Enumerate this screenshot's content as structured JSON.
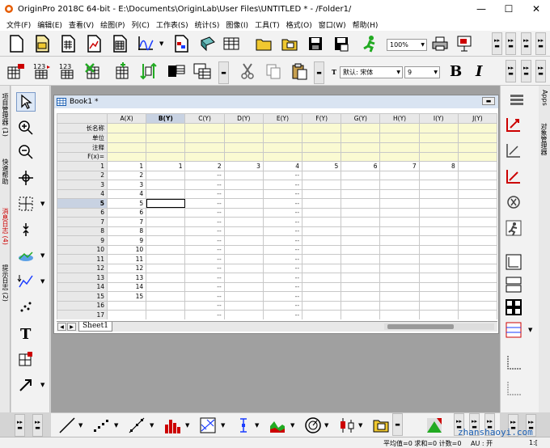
{
  "window": {
    "title": "OriginPro 2018C 64-bit - E:\\Documents\\OriginLab\\User Files\\UNTITLED * - /Folder1/",
    "minimize": "—",
    "maximize": "☐",
    "close": "✕"
  },
  "menu": [
    "文件(F)",
    "编辑(E)",
    "查看(V)",
    "绘图(P)",
    "列(C)",
    "工作表(S)",
    "统计(S)",
    "图像(I)",
    "工具(T)",
    "格式(O)",
    "窗口(W)",
    "帮助(H)"
  ],
  "toolbar": {
    "zoom": "100%",
    "font_name": "默认: 宋体",
    "font_size": "9",
    "bold": "B",
    "italic": "I",
    "font_icon_label": "T"
  },
  "left_dock": {
    "tabs": [
      "项目管理器 (1)",
      "快速帮助",
      "消息日志 (4)",
      "提示日志 (2)"
    ]
  },
  "right_dock": {
    "tabs": [
      "Apps",
      "对象管理器"
    ]
  },
  "book": {
    "title": "Book1 *",
    "columns": [
      "A(X)",
      "B(Y)",
      "C(Y)",
      "D(Y)",
      "E(Y)",
      "F(Y)",
      "G(Y)",
      "H(Y)",
      "I(Y)",
      "J(Y)"
    ],
    "meta_rows": [
      "长名称",
      "单位",
      "注释",
      "F(x)="
    ],
    "rows": [
      [
        "1",
        "1",
        "1",
        "2",
        "3",
        "4",
        "5",
        "6",
        "7",
        "8",
        ""
      ],
      [
        "2",
        "2",
        "",
        "--",
        "",
        "--",
        "",
        "",
        "",
        "",
        ""
      ],
      [
        "3",
        "3",
        "",
        "--",
        "",
        "--",
        "",
        "",
        "",
        "",
        ""
      ],
      [
        "4",
        "4",
        "",
        "--",
        "",
        "--",
        "",
        "",
        "",
        "",
        ""
      ],
      [
        "5",
        "5",
        "",
        "--",
        "",
        "--",
        "",
        "",
        "",
        "",
        ""
      ],
      [
        "6",
        "6",
        "",
        "--",
        "",
        "--",
        "",
        "",
        "",
        "",
        ""
      ],
      [
        "7",
        "7",
        "",
        "--",
        "",
        "--",
        "",
        "",
        "",
        "",
        ""
      ],
      [
        "8",
        "8",
        "",
        "--",
        "",
        "--",
        "",
        "",
        "",
        "",
        ""
      ],
      [
        "9",
        "9",
        "",
        "--",
        "",
        "--",
        "",
        "",
        "",
        "",
        ""
      ],
      [
        "10",
        "10",
        "",
        "--",
        "",
        "--",
        "",
        "",
        "",
        "",
        ""
      ],
      [
        "11",
        "11",
        "",
        "--",
        "",
        "--",
        "",
        "",
        "",
        "",
        ""
      ],
      [
        "12",
        "12",
        "",
        "--",
        "",
        "--",
        "",
        "",
        "",
        "",
        ""
      ],
      [
        "13",
        "13",
        "",
        "--",
        "",
        "--",
        "",
        "",
        "",
        "",
        ""
      ],
      [
        "14",
        "14",
        "",
        "--",
        "",
        "--",
        "",
        "",
        "",
        "",
        ""
      ],
      [
        "15",
        "15",
        "",
        "--",
        "",
        "--",
        "",
        "",
        "",
        "",
        ""
      ],
      [
        "16",
        "",
        "",
        "--",
        "",
        "--",
        "",
        "",
        "",
        "",
        ""
      ],
      [
        "17",
        "",
        "",
        "--",
        "",
        "--",
        "",
        "",
        "",
        "",
        ""
      ]
    ],
    "selected_column": "B(Y)",
    "selected_row": "5",
    "sheet_tab": "Sheet1"
  },
  "status": {
    "stats": "平均值=0 求和=0 计数=0",
    "au": "AU : 开",
    "page": "1:[",
    "watermark": "zhanshaoyi.com"
  },
  "colors": {
    "meta_fill": "#fafad2",
    "selected_header": "#c8d2e2",
    "workspace": "#a0a0a0",
    "accent_red": "#cc0000",
    "accent_green": "#22aa22"
  }
}
